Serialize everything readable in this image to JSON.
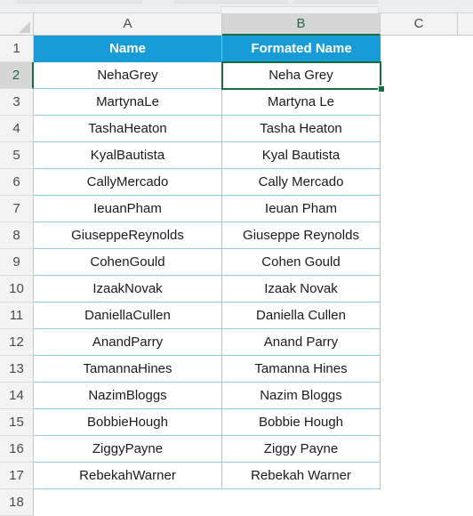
{
  "app": {
    "name": "spreadsheet",
    "colors": {
      "header_fill": "#189cd8",
      "header_text": "#ffffff",
      "gridline": "#8ecfe8",
      "active_border": "#1d6b41",
      "header_band": "#f3f3f3",
      "active_header_band": "#d6d6d6"
    }
  },
  "columns": [
    {
      "label": "A",
      "active": false
    },
    {
      "label": "B",
      "active": true
    },
    {
      "label": "C",
      "active": false
    }
  ],
  "rows": [
    "1",
    "2",
    "3",
    "4",
    "5",
    "6",
    "7",
    "8",
    "9",
    "10",
    "11",
    "12",
    "13",
    "14",
    "15",
    "16",
    "17",
    "18"
  ],
  "active_cell": "B2",
  "active_row": "2",
  "active_column": "B",
  "table": {
    "headers": [
      "Name",
      "Formated Name"
    ],
    "rows": [
      {
        "row": "2",
        "name": "NehaGrey",
        "formated_name": "Neha Grey"
      },
      {
        "row": "3",
        "name": "MartynaLe",
        "formated_name": "Martyna Le"
      },
      {
        "row": "4",
        "name": "TashaHeaton",
        "formated_name": "Tasha Heaton"
      },
      {
        "row": "5",
        "name": "KyalBautista",
        "formated_name": "Kyal Bautista"
      },
      {
        "row": "6",
        "name": "CallyMercado",
        "formated_name": "Cally Mercado"
      },
      {
        "row": "7",
        "name": "IeuanPham",
        "formated_name": "Ieuan Pham"
      },
      {
        "row": "8",
        "name": "GiuseppeReynolds",
        "formated_name": "Giuseppe Reynolds"
      },
      {
        "row": "9",
        "name": "CohenGould",
        "formated_name": "Cohen Gould"
      },
      {
        "row": "10",
        "name": "IzaakNovak",
        "formated_name": "Izaak Novak"
      },
      {
        "row": "11",
        "name": "DaniellaCullen",
        "formated_name": "Daniella Cullen"
      },
      {
        "row": "12",
        "name": "AnandParry",
        "formated_name": "Anand Parry"
      },
      {
        "row": "13",
        "name": "TamannaHines",
        "formated_name": "Tamanna Hines"
      },
      {
        "row": "14",
        "name": "NazimBloggs",
        "formated_name": "Nazim Bloggs"
      },
      {
        "row": "15",
        "name": "BobbieHough",
        "formated_name": "Bobbie Hough"
      },
      {
        "row": "16",
        "name": "ZiggyPayne",
        "formated_name": "Ziggy Payne"
      },
      {
        "row": "17",
        "name": "RebekahWarner",
        "formated_name": "Rebekah Warner"
      }
    ]
  }
}
